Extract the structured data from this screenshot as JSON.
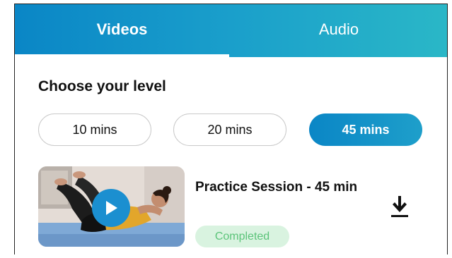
{
  "tabs": [
    {
      "label": "Videos",
      "active": true
    },
    {
      "label": "Audio",
      "active": false
    }
  ],
  "heading": "Choose your level",
  "levels": [
    {
      "label": "10 mins",
      "selected": false
    },
    {
      "label": "20 mins",
      "selected": false
    },
    {
      "label": "45 mins",
      "selected": true
    }
  ],
  "session": {
    "title": "Practice Session - 45 min",
    "status": "Completed",
    "thumbnail": "yoga-pose-thumbnail",
    "play_icon": "play-icon",
    "download_icon": "download-icon"
  },
  "colors": {
    "accent_start": "#0a86c6",
    "accent_end": "#2ab7c7",
    "badge_bg": "#d9f3e0",
    "badge_text": "#5cc47a"
  }
}
